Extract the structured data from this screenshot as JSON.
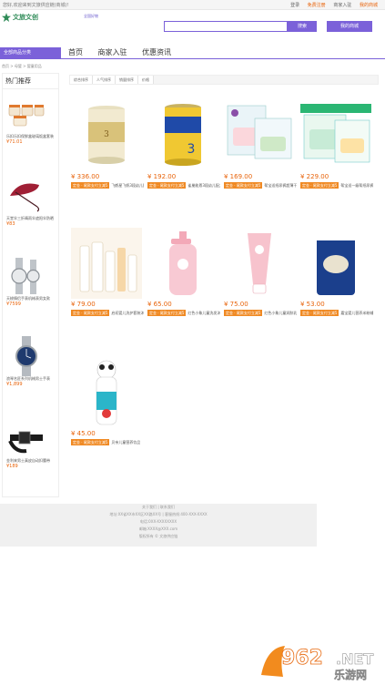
{
  "topbar": {
    "welcome": "您好,欢迎来到文旅供应链(商城)!",
    "links": [
      "登录",
      "免费注册",
      "商家入驻",
      "我的商城"
    ]
  },
  "header": {
    "logo_text": "文旅文创",
    "tagline": "全国好物",
    "search_placeholder": "",
    "search_button": "搜索",
    "shop_button": "我的商城"
  },
  "category_bar": {
    "label": "全部商品分类"
  },
  "nav": [
    "首页",
    "商家入驻",
    "优惠资讯"
  ],
  "breadcrumb": "首页 > 母婴 > 婴童用品",
  "sidebar": {
    "title": "热门推荐",
    "items": [
      {
        "name": "乐扣乐扣保鲜盒玻璃饭盒套装",
        "price": "¥71.01"
      },
      {
        "name": "天堂伞三折晴雨伞遮阳伞防晒",
        "price": "¥83"
      },
      {
        "name": "天梭情侣手表机械表男女款",
        "price": "¥7599"
      },
      {
        "name": "浪琴名匠系列机械男士手表",
        "price": "¥1,899"
      },
      {
        "name": "金利来男士真皮自动扣腰带",
        "price": "¥189"
      }
    ]
  },
  "filters": [
    "综合排序",
    "人气排序",
    "销量排序",
    "价格"
  ],
  "products": [
    {
      "price": "¥ 336.00",
      "tag": "定金 · 尾款支付立减5",
      "title": "飞鹤星飞帆3段幼儿配方奶粉"
    },
    {
      "price": "¥ 192.00",
      "tag": "定金 · 尾款支付立减5",
      "title": "雀巢能恩3段幼儿配方奶粉"
    },
    {
      "price": "¥ 169.00",
      "tag": "定金 · 尾款支付立减5",
      "title": "帮宝适纸尿裤超薄干爽大包装"
    },
    {
      "price": "¥ 229.00",
      "tag": "定金 · 尾款支付立减5",
      "title": "帮宝适一级帮纸尿裤M码"
    },
    {
      "price": "¥ 79.00",
      "tag": "定金 · 尾款支付立减5",
      "title": "启初婴儿洗护套装沐浴露"
    },
    {
      "price": "¥ 65.00",
      "tag": "定金 · 尾款支付立减5",
      "title": "红色小象儿童洗发沐浴露"
    },
    {
      "price": "¥ 75.00",
      "tag": "定金 · 尾款支付立减5",
      "title": "红色小象儿童润肤乳面霜"
    },
    {
      "price": "¥ 53.00",
      "tag": "定金 · 尾款支付立减5",
      "title": "嘉宝婴儿营养米粉辅食"
    },
    {
      "price": "¥ 45.00",
      "tag": "定金 · 尾款支付立减5",
      "title": "贝亲儿童营养饮品"
    }
  ],
  "footer": {
    "lines": [
      "关于我们 | 联系我们",
      "地址:XX省XX市XX区XX路XX号 | 客服热线:400-XXX-XXXX",
      "电话:0XX-XXXXXXXX",
      "邮箱:XXXX@XXX.com",
      "版权所有 © 文旅供应链"
    ]
  },
  "watermark": {
    "number": "962",
    "suffix": ".NET",
    "sub": "乐游网"
  },
  "colors": {
    "accent": "#7b61d9",
    "price": "#e8630a",
    "tag": "#f08a24"
  }
}
